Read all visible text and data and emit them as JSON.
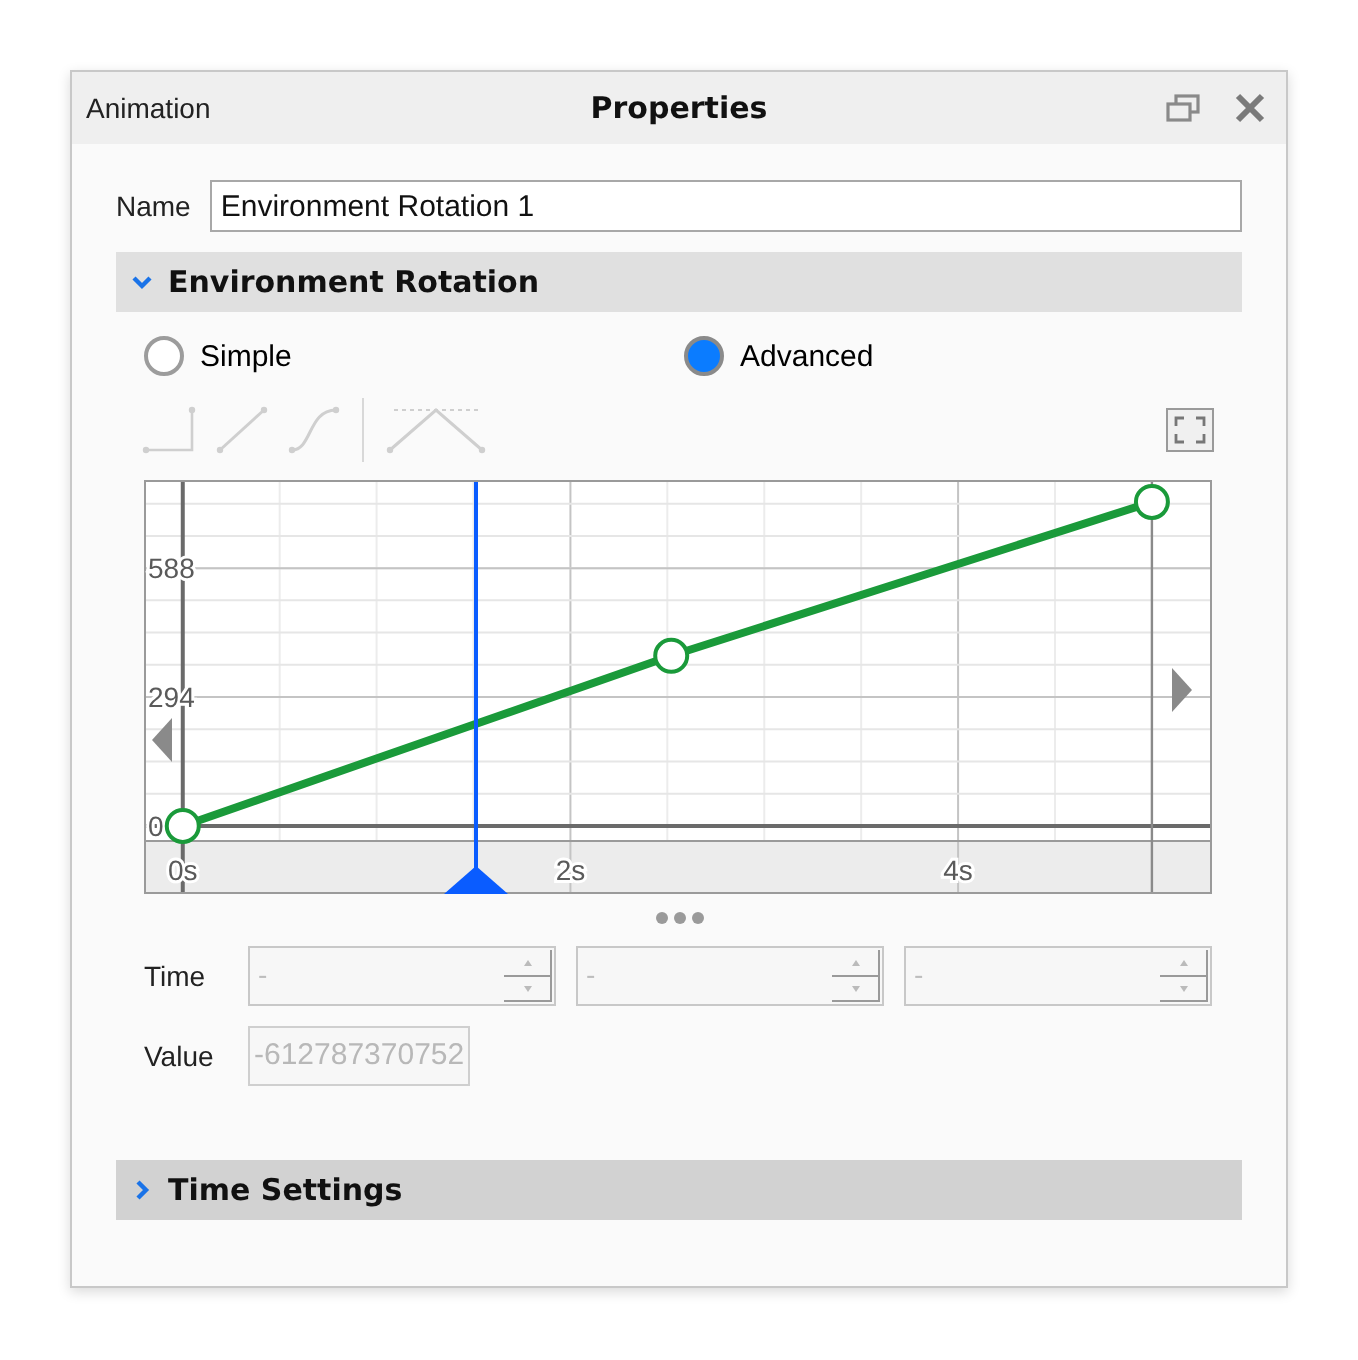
{
  "panel": {
    "side_title": "Animation",
    "title": "Properties"
  },
  "name_field": {
    "label": "Name",
    "value": "Environment Rotation 1"
  },
  "rotation_section": {
    "title": "Environment Rotation",
    "expanded": true
  },
  "mode_options": [
    {
      "label": "Simple",
      "selected": false
    },
    {
      "label": "Advanced",
      "selected": true
    }
  ],
  "curve_editor": {
    "chart_data": {
      "type": "line",
      "x": [
        0,
        2.52,
        5.0
      ],
      "series": [
        {
          "color": "#1a9a3a",
          "marker": "circle",
          "values": [
            0,
            388,
            739
          ]
        }
      ],
      "xlim": [
        -0.2,
        5.31
      ],
      "ylim": [
        -32,
        789
      ],
      "grid": true,
      "xticks": [
        {
          "value": 0,
          "label": "0s"
        },
        {
          "value": 2,
          "label": "2s"
        },
        {
          "value": 4,
          "label": "4s"
        }
      ],
      "yticks": [
        0,
        294,
        588
      ],
      "ref_lines": [
        {
          "axis": "x",
          "value": 5.0,
          "color": "#8a8a8a"
        }
      ]
    },
    "playhead": {
      "level": 0.311
    }
  },
  "time_label": "Time",
  "time_fields": [
    {
      "value": "-",
      "disabled": true
    },
    {
      "value": "-",
      "disabled": true
    },
    {
      "value": "-",
      "disabled": true
    }
  ],
  "value_field": {
    "label": "Value",
    "value": "-612787370752",
    "disabled": true
  },
  "time_section": {
    "title": "Time Settings",
    "expanded": false
  }
}
